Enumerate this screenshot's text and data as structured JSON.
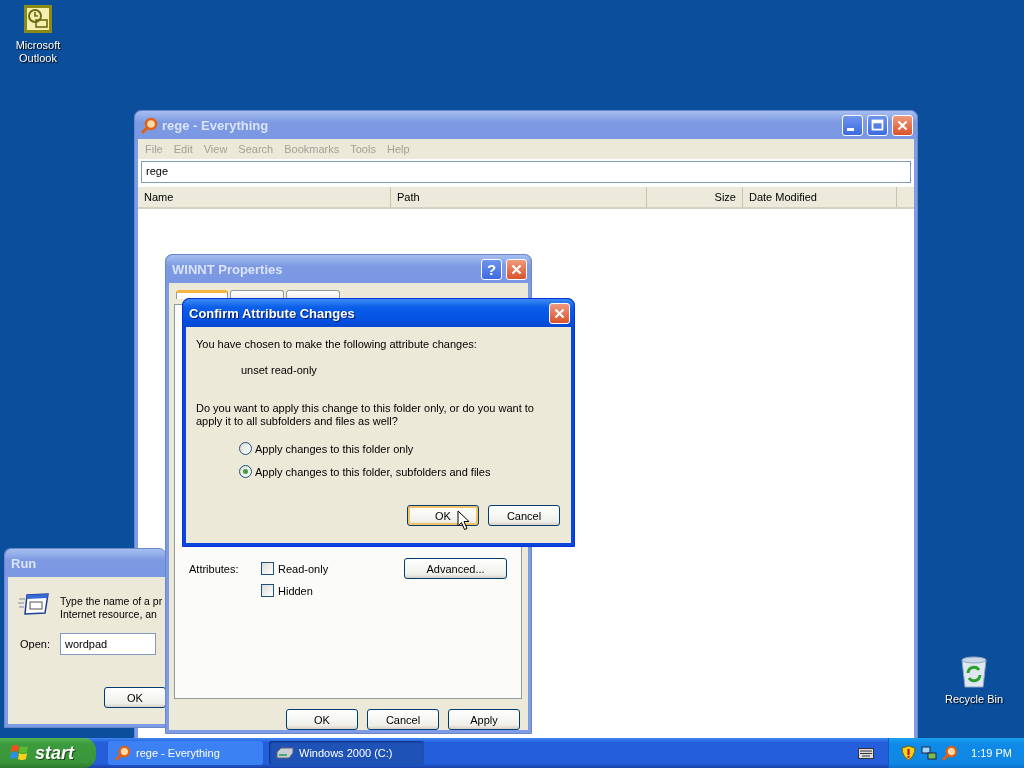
{
  "desktop_icons": [
    {
      "kind": "outlook",
      "label": "Microsoft Outlook"
    },
    {
      "kind": "recycle-bin",
      "label": "Recycle Bin"
    }
  ],
  "everything_window": {
    "title": "rege - Everything",
    "active": false,
    "menu_enabled": false,
    "menu": [
      "File",
      "Edit",
      "View",
      "Search",
      "Bookmarks",
      "Tools",
      "Help"
    ],
    "search": {
      "value": "rege"
    },
    "columns": [
      {
        "label": "Name"
      },
      {
        "label": "Path"
      },
      {
        "label": "Size"
      },
      {
        "label": "Date Modified"
      }
    ]
  },
  "run_dialog": {
    "title": "Run",
    "active": false,
    "description": [
      "Type the name of a pr",
      "Internet resource, an"
    ],
    "open_label": "Open:",
    "value": "wordpad",
    "buttons": [
      "OK"
    ]
  },
  "properties_dialog": {
    "title": "WINNT Properties",
    "active": false,
    "help_button": "?",
    "tabs": [
      {
        "selected": true
      },
      {
        "selected": false
      },
      {
        "selected": false
      }
    ],
    "attributes_label": "Attributes:",
    "checkboxes": [
      {
        "label": "Read-only",
        "checked": false
      },
      {
        "label": "Hidden",
        "checked": false
      }
    ],
    "advanced_button": "Advanced...",
    "buttons": [
      "OK",
      "Cancel",
      "Apply"
    ]
  },
  "confirm_dialog": {
    "title": "Confirm Attribute Changes",
    "active": true,
    "message": "You have chosen to make the following attribute changes:",
    "change": "unset read-only",
    "question": "Do you want to apply this change to this folder only, or do you want to apply it to all subfolders and files as well?",
    "options": [
      {
        "label": "Apply changes to this folder only",
        "selected": false
      },
      {
        "label": "Apply changes to this folder, subfolders and files",
        "selected": true
      }
    ],
    "buttons": [
      {
        "label": "OK",
        "default": true
      },
      {
        "label": "Cancel",
        "default": false
      }
    ]
  },
  "taskbar": {
    "start": "start",
    "tasks": [
      {
        "kind": "everything",
        "label": "rege - Everything",
        "selected": false
      },
      {
        "kind": "drive",
        "label": "Windows 2000 (C:)",
        "selected": true
      }
    ],
    "clock": "1:19 PM"
  }
}
